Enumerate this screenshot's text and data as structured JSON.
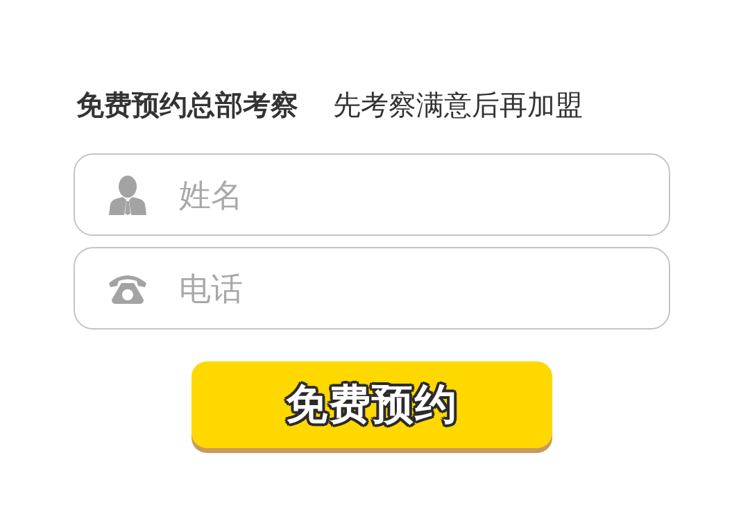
{
  "heading": {
    "title": "免费预约总部考察",
    "subtitle": "先考察满意后再加盟"
  },
  "fields": [
    {
      "kind": "person",
      "placeholder": "姓名"
    },
    {
      "kind": "phone",
      "placeholder": "电话"
    }
  ],
  "submit": {
    "label": "免费预约"
  }
}
